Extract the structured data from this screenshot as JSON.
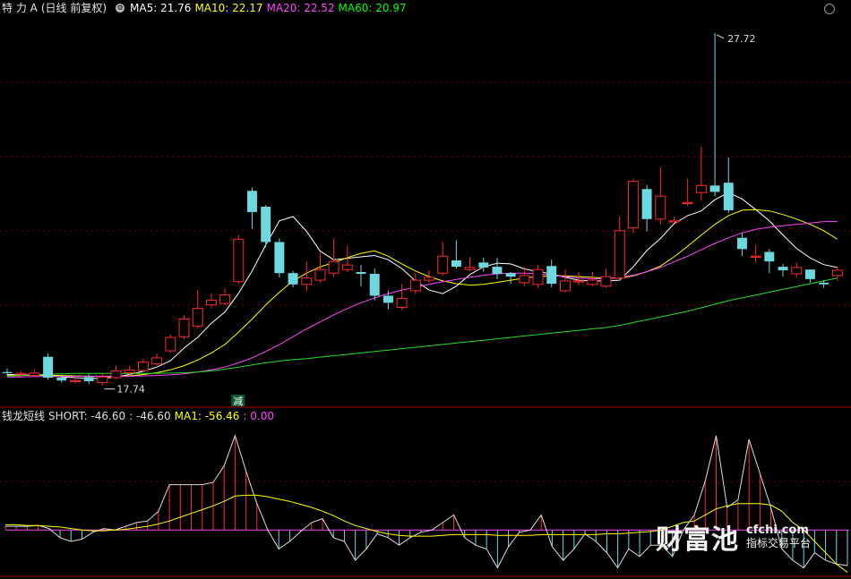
{
  "main_header": {
    "stock": "特 力 A",
    "mode": "(日线 前复权)",
    "ma": [
      {
        "label": "MA5: 21.76",
        "color": "#ffffff"
      },
      {
        "label": "MA10: 22.17",
        "color": "#ffff00"
      },
      {
        "label": "MA20: 22.52",
        "color": "#ff44ff"
      },
      {
        "label": "MA60: 20.97",
        "color": "#00ff00"
      }
    ]
  },
  "annotations": {
    "high": "27.72",
    "low": "17.74",
    "tag": "减"
  },
  "sub_header": {
    "name": "钱龙短线",
    "items": [
      {
        "label": "SHORT: -46.60",
        "color": "#dddddd"
      },
      {
        "label": ": -46.60",
        "color": "#dddddd"
      },
      {
        "label": "MA1: -56.46",
        "color": "#ffff00"
      },
      {
        "label": ": 0.00",
        "color": "#ff44ff"
      }
    ]
  },
  "watermark": {
    "cn": "财富池",
    "domain": "cfchi.com",
    "sub": "指标交易平台"
  },
  "colors": {
    "up": "#ff2a2a",
    "down": "#6ed8e0",
    "grid": "#7a0000"
  },
  "chart_data": [
    {
      "type": "candlestick",
      "title": "特力A 日线 前复权",
      "ylim": [
        17.2,
        28.4
      ],
      "high_mark": 27.72,
      "low_mark": 17.74,
      "candles": [
        [
          18.12,
          18.1,
          18.22,
          18.02
        ],
        [
          18.05,
          18.08,
          18.15,
          17.96
        ],
        [
          18.02,
          18.09,
          18.18,
          17.98
        ],
        [
          18.55,
          17.96,
          18.65,
          17.9
        ],
        [
          17.96,
          17.88,
          18.04,
          17.82
        ],
        [
          17.85,
          17.88,
          17.96,
          17.8
        ],
        [
          17.98,
          17.86,
          18.06,
          17.78
        ],
        [
          17.82,
          17.98,
          18.08,
          17.74
        ],
        [
          17.96,
          18.15,
          18.3,
          17.92
        ],
        [
          18.1,
          18.17,
          18.3,
          18.02
        ],
        [
          18.16,
          18.4,
          18.5,
          18.12
        ],
        [
          18.35,
          18.52,
          18.65,
          18.3
        ],
        [
          18.72,
          19.1,
          19.18,
          18.65
        ],
        [
          19.12,
          19.62,
          19.72,
          19.05
        ],
        [
          19.42,
          19.92,
          20.45,
          19.35
        ],
        [
          20.02,
          20.15,
          20.35,
          19.92
        ],
        [
          20.06,
          20.3,
          20.5,
          20.02
        ],
        [
          20.68,
          21.88,
          22.0,
          20.62
        ],
        [
          23.25,
          22.65,
          23.35,
          22.18
        ],
        [
          22.8,
          21.8,
          22.85,
          21.65
        ],
        [
          21.8,
          20.92,
          21.9,
          20.8
        ],
        [
          20.92,
          20.6,
          20.98,
          20.52
        ],
        [
          20.6,
          20.78,
          21.25,
          20.4
        ],
        [
          20.72,
          21.02,
          21.48,
          20.65
        ],
        [
          20.92,
          21.25,
          21.9,
          20.82
        ],
        [
          21.02,
          21.15,
          21.7,
          20.95
        ],
        [
          20.95,
          20.9,
          21.15,
          20.55
        ],
        [
          20.9,
          20.28,
          21.05,
          20.15
        ],
        [
          20.28,
          20.08,
          20.42,
          19.9
        ],
        [
          19.95,
          20.2,
          20.62,
          19.88
        ],
        [
          20.42,
          20.72,
          20.92,
          20.32
        ],
        [
          20.72,
          20.8,
          21.0,
          20.66
        ],
        [
          20.92,
          21.4,
          21.8,
          20.85
        ],
        [
          21.28,
          21.1,
          21.85,
          21.05
        ],
        [
          21.02,
          21.08,
          21.38,
          20.98
        ],
        [
          21.22,
          21.08,
          21.36,
          20.96
        ],
        [
          21.1,
          20.9,
          21.35,
          20.75
        ],
        [
          20.92,
          20.82,
          20.95,
          20.62
        ],
        [
          20.65,
          20.85,
          21.1,
          20.55
        ],
        [
          20.6,
          21.02,
          21.15,
          20.5
        ],
        [
          21.12,
          20.62,
          21.3,
          20.52
        ],
        [
          20.42,
          20.7,
          21.02,
          20.38
        ],
        [
          20.7,
          20.7,
          20.95,
          20.58
        ],
        [
          20.6,
          20.72,
          20.96,
          20.55
        ],
        [
          20.55,
          20.82,
          21.05,
          20.5
        ],
        [
          20.78,
          22.12,
          22.52,
          20.72
        ],
        [
          22.2,
          23.52,
          23.6,
          22.05
        ],
        [
          23.3,
          22.45,
          23.42,
          22.1
        ],
        [
          22.45,
          23.1,
          23.92,
          22.3
        ],
        [
          22.4,
          22.4,
          22.52,
          22.35
        ],
        [
          22.92,
          22.92,
          23.6,
          22.82
        ],
        [
          23.2,
          23.4,
          24.5,
          22.98
        ],
        [
          23.4,
          23.22,
          27.72,
          23.1
        ],
        [
          23.48,
          22.7,
          24.2,
          22.62
        ],
        [
          21.92,
          21.6,
          22.05,
          21.4
        ],
        [
          21.4,
          21.4,
          21.72,
          21.22
        ],
        [
          21.52,
          21.25,
          21.6,
          20.92
        ],
        [
          21.1,
          21.0,
          21.18,
          20.82
        ],
        [
          20.9,
          21.08,
          21.22,
          20.8
        ],
        [
          21.02,
          20.75,
          21.02,
          20.65
        ],
        [
          20.65,
          20.6,
          20.72,
          20.5
        ],
        [
          20.85,
          21.0,
          21.1,
          20.7
        ]
      ],
      "series": [
        {
          "name": "MA5",
          "color": "#ffffff",
          "values": [
            18.05,
            18.04,
            18.04,
            18.02,
            17.98,
            17.96,
            17.94,
            17.94,
            17.98,
            18.05,
            18.14,
            18.26,
            18.44,
            18.8,
            19.1,
            19.5,
            19.82,
            20.35,
            20.98,
            21.72,
            22.4,
            22.52,
            22.1,
            21.54,
            21.3,
            21.34,
            21.38,
            21.42,
            21.3,
            21.05,
            20.7,
            20.44,
            20.34,
            20.55,
            20.88,
            21.1,
            21.2,
            21.18,
            21.04,
            20.96,
            20.9,
            20.8,
            20.72,
            20.7,
            20.7,
            20.72,
            21.1,
            21.56,
            21.9,
            22.32,
            22.55,
            22.68,
            23.0,
            23.2,
            23.02,
            22.72,
            22.4,
            22.0,
            21.62,
            21.35,
            21.16,
            21.08
          ]
        },
        {
          "name": "MA10",
          "color": "#ffff00",
          "values": [
            18.02,
            18.02,
            18.03,
            18.03,
            18.02,
            18.01,
            18.0,
            17.99,
            17.99,
            18.01,
            18.05,
            18.1,
            18.18,
            18.3,
            18.46,
            18.66,
            18.9,
            19.25,
            19.62,
            20.02,
            20.38,
            20.7,
            20.92,
            21.1,
            21.22,
            21.36,
            21.48,
            21.55,
            21.4,
            21.18,
            20.98,
            20.82,
            20.7,
            20.62,
            20.58,
            20.6,
            20.66,
            20.72,
            20.78,
            20.82,
            20.84,
            20.84,
            20.82,
            20.8,
            20.78,
            20.78,
            20.84,
            20.96,
            21.12,
            21.38,
            21.68,
            22.0,
            22.3,
            22.55,
            22.7,
            22.72,
            22.68,
            22.58,
            22.45,
            22.3,
            22.12,
            21.88
          ]
        },
        {
          "name": "MA20",
          "color": "#ff44ff",
          "values": [
            17.98,
            17.98,
            17.99,
            17.99,
            17.99,
            18.0,
            18.0,
            18.0,
            18.0,
            18.0,
            18.01,
            18.02,
            18.04,
            18.07,
            18.12,
            18.18,
            18.26,
            18.38,
            18.52,
            18.7,
            18.9,
            19.12,
            19.34,
            19.54,
            19.74,
            19.92,
            20.08,
            20.22,
            20.34,
            20.44,
            20.52,
            20.6,
            20.68,
            20.74,
            20.8,
            20.86,
            20.9,
            20.92,
            20.92,
            20.9,
            20.86,
            20.82,
            20.78,
            20.76,
            20.76,
            20.8,
            20.86,
            20.96,
            21.08,
            21.24,
            21.4,
            21.58,
            21.76,
            21.92,
            22.06,
            22.16,
            22.22,
            22.26,
            22.3,
            22.34,
            22.38,
            22.38
          ]
        },
        {
          "name": "MA60",
          "color": "#22dd22",
          "values": [
            18.0,
            18.02,
            18.04,
            18.06,
            18.07,
            18.08,
            18.08,
            18.08,
            18.08,
            18.08,
            18.08,
            18.08,
            18.09,
            18.1,
            18.12,
            18.15,
            18.2,
            18.26,
            18.32,
            18.38,
            18.43,
            18.47,
            18.5,
            18.54,
            18.58,
            18.62,
            18.66,
            18.7,
            18.74,
            18.78,
            18.82,
            18.86,
            18.9,
            18.94,
            18.98,
            19.02,
            19.06,
            19.1,
            19.14,
            19.18,
            19.22,
            19.26,
            19.3,
            19.34,
            19.38,
            19.44,
            19.52,
            19.6,
            19.68,
            19.76,
            19.84,
            19.94,
            20.04,
            20.14,
            20.22,
            20.3,
            20.38,
            20.46,
            20.54,
            20.62,
            20.7,
            20.78
          ]
        }
      ]
    },
    {
      "type": "bar",
      "title": "钱龙短线",
      "ylim": [
        -60,
        140
      ],
      "series": [
        {
          "name": "SHORT",
          "color": "#dddddd",
          "values": [
            5,
            5,
            5,
            6,
            2,
            -10,
            -15,
            -12,
            -3,
            2,
            0,
            5,
            10,
            12,
            25,
            60,
            60,
            60,
            60,
            63,
            85,
            125,
            78,
            35,
            0,
            -25,
            -15,
            -2,
            10,
            15,
            -10,
            -15,
            -40,
            -25,
            -5,
            -10,
            -20,
            -10,
            -3,
            0,
            10,
            20,
            -10,
            -20,
            -25,
            -50,
            -22,
            -3,
            0,
            20,
            -22,
            -40,
            -25,
            -5,
            -15,
            -30,
            -50,
            -25,
            -35,
            -20,
            -20,
            -35,
            0,
            20,
            65,
            125,
            30,
            40,
            120,
            75,
            30,
            -25,
            -40,
            -50,
            -30,
            -40,
            -45,
            -47
          ]
        },
        {
          "name": "MA1",
          "color": "#ffff00",
          "values": [
            7,
            7,
            6,
            6,
            5,
            4,
            2,
            0,
            -1,
            -1,
            0,
            1,
            3,
            5,
            8,
            12,
            17,
            22,
            27,
            32,
            38,
            45,
            46,
            46,
            44,
            41,
            38,
            34,
            30,
            25,
            19,
            12,
            6,
            2,
            -2,
            -5,
            -7,
            -8,
            -8,
            -8,
            -7,
            -6,
            -6,
            -6,
            -6,
            -7,
            -7,
            -7,
            -7,
            -6,
            -6,
            -6,
            -6,
            -6,
            -6,
            -5,
            -5,
            -4,
            -3,
            -2,
            0,
            5,
            10,
            12,
            20,
            28,
            32,
            35,
            35,
            35,
            33,
            25,
            10,
            0,
            -15,
            -30,
            -45,
            -56
          ]
        }
      ]
    }
  ]
}
